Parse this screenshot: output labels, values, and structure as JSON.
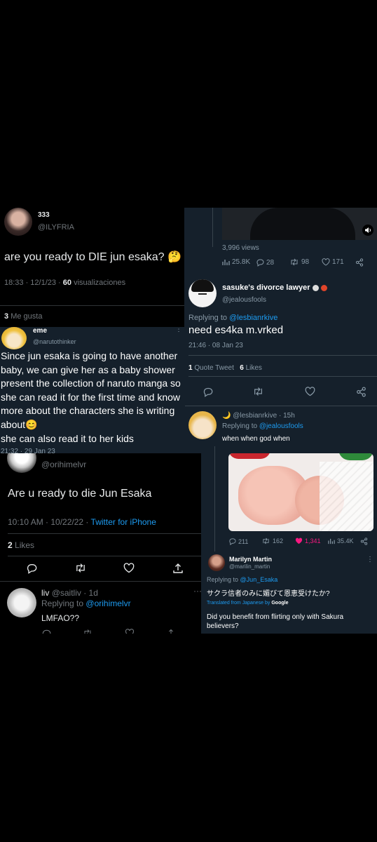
{
  "t1": {
    "display_name": "333",
    "handle": "@ILYFRIA",
    "text": "are you ready to DIE jun esaka?",
    "emoji": "🤔",
    "time": "18:33 · 12/1/23 ·",
    "views_count": "60",
    "views_label": "visualizaciones",
    "likes_count": "3",
    "likes_label": "Me gusta"
  },
  "t2": {
    "views": "3,996 views",
    "stats": {
      "views": "25.8K",
      "replies": "28",
      "retweets": "98",
      "likes": "171"
    },
    "display_name": "sasuke's divorce lawyer",
    "handle": "@jealousfools",
    "replying_prefix": "Replying to",
    "replying_handle": "@lesbianrkive",
    "text": "need es4ka m.vrked",
    "time": "21:46 · 08 Jan 23",
    "quote_count": "1",
    "quote_label": "Quote Tweet",
    "likes_count": "6",
    "likes_label": "Likes"
  },
  "t2reply": {
    "emoji": "🌙",
    "handle": "@lesbianrkive · 15h",
    "replying_prefix": "Replying to",
    "replying_handle": "@jealousfools",
    "text": "when when god when"
  },
  "t3": {
    "display_name": "eme",
    "handle": "@narutothinker",
    "text": "Since jun esaka is going to have another baby, we can give her as a baby shower present the collection of naruto manga so she can read it for the first time and know more about the characters she is writing about",
    "emoji": "😊",
    "text2": "she can also read it to her kids",
    "time_cut": "21:32 · 29 Jan 23"
  },
  "t4": {
    "handle": "@orihimelvr",
    "text": "Are u ready to die Jun Esaka",
    "time": "10:10 AM · 10/22/22 ·",
    "source": "Twitter for iPhone",
    "likes_count": "2",
    "likes_label": "Likes"
  },
  "t4reply": {
    "display_name": "liv",
    "handle": "@saitliv · 1d",
    "replying_prefix": "Replying to",
    "replying_handle": "@orihimelvr",
    "text": "LMFAO??"
  },
  "t5": {
    "stats": {
      "replies": "211",
      "retweets": "162",
      "likes": "1,341",
      "views": "35.4K"
    },
    "display_name": "Marilyn Martin",
    "handle": "@marilin_martin",
    "replying_prefix": "Replying to",
    "replying_handle": "@Jun_Esaka",
    "text_jp": "サクラ信者のみに媚びて恩恵受けたか?",
    "translated_prefix": "Translated from Japanese by",
    "translated_brand": "Google",
    "text_en": "Did you benefit from flirting only with Sakura believers?"
  }
}
